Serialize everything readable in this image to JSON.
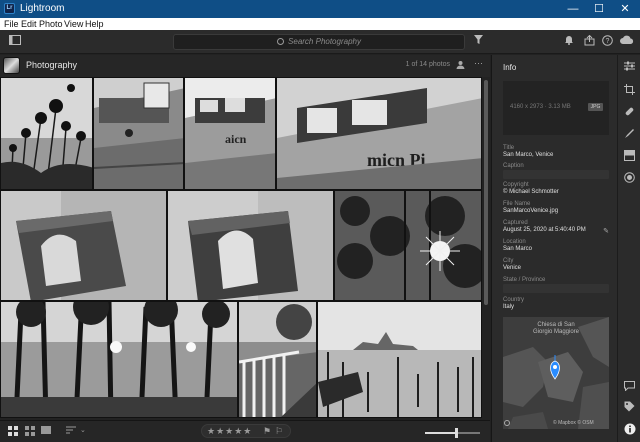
{
  "window": {
    "app_badge": "Lr",
    "title": "Lightroom",
    "minimize": "—",
    "maximize": "☐",
    "close": "✕"
  },
  "menu": [
    "File",
    "Edit",
    "Photo",
    "View",
    "Help"
  ],
  "toolbar": {
    "search_placeholder": "Search Photography",
    "icons": [
      "panel-toggle-icon",
      "filter-icon",
      "bell-icon",
      "share-icon",
      "help-icon",
      "cloud-icon"
    ]
  },
  "grid_header": {
    "album_title": "Photography",
    "photo_count": "1 of 14 photos"
  },
  "bottom_bar": {
    "rating_stars": "★★★★★",
    "zoom_fraction": 0.56
  },
  "info_panel": {
    "title": "Info",
    "dimensions": "4160 x 2973 · 3.13 MB",
    "format": "JPG",
    "fields": {
      "title_label": "Title",
      "title_value": "San Marco, Venice",
      "caption_label": "Caption",
      "copyright_label": "Copyright",
      "copyright_value": "© Michael Schmotter",
      "filename_label": "File Name",
      "filename_value": "SanMarcoVenice.jpg",
      "captured_label": "Captured",
      "captured_value": "August 25, 2020 at 5:40:40 PM",
      "location_label": "Location",
      "location_value": "San Marco",
      "city_label": "City",
      "city_value": "Venice",
      "state_label": "State / Province",
      "country_label": "Country",
      "country_value": "Italy"
    },
    "map": {
      "place_label": "Chiesa di San Giorgio Maggiore",
      "attribution": "© Mapbox © OSM"
    }
  },
  "colors": {
    "title_bar": "#0f4e86",
    "panel_bg": "#2b2b2b",
    "map_marker": "#2a8cff"
  }
}
